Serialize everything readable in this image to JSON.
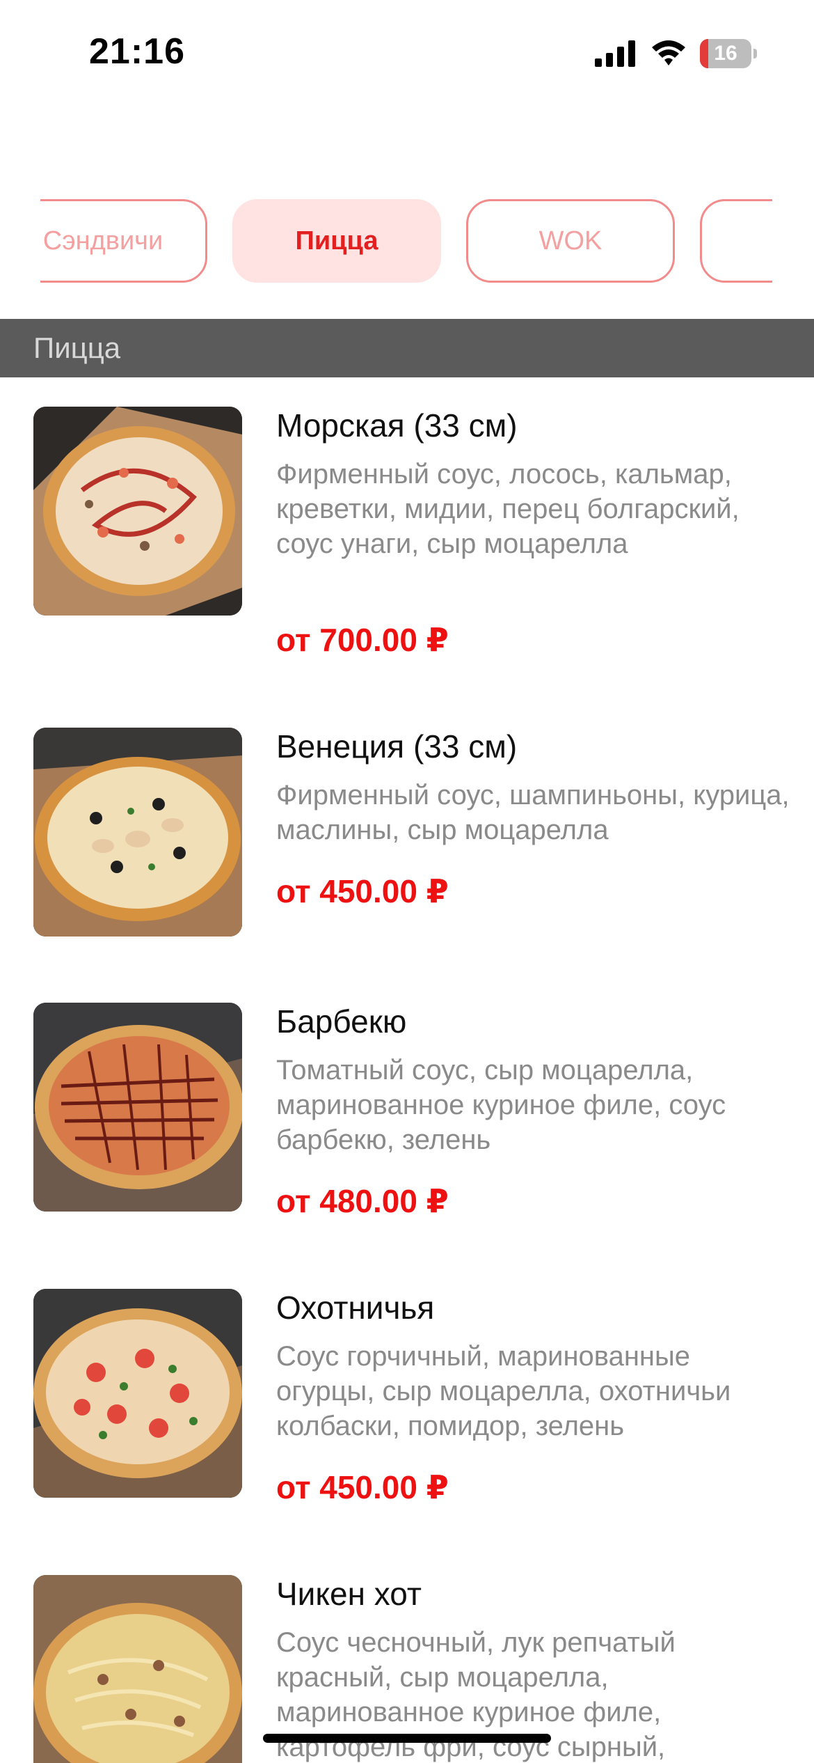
{
  "status_bar": {
    "time": "21:16",
    "battery_level": "16"
  },
  "tabs": [
    {
      "label": "Сэндвичи",
      "active": false
    },
    {
      "label": "Пицца",
      "active": true
    },
    {
      "label": "WOK",
      "active": false
    },
    {
      "label": "",
      "active": false
    }
  ],
  "section": {
    "title": "Пицца"
  },
  "products": [
    {
      "name": "Морская (33 см)",
      "description": "Фирменный соус, лосось, кальмар, креветки, мидии, перец болгарский, соус унаги, сыр моцарелла",
      "price": "от 700.00 ₽"
    },
    {
      "name": "Венеция (33 см)",
      "description": "Фирменный соус, шампиньоны, курица, маслины, сыр моцарелла",
      "price": "от 450.00 ₽"
    },
    {
      "name": "Барбекю",
      "description": "Томатный соус, сыр моцарелла, маринованное куриное филе, соус барбекю, зелень",
      "price": "от 480.00 ₽"
    },
    {
      "name": "Охотничья",
      "description": "Соус горчичный, маринованные огурцы, сыр моцарелла, охотничьи колбаски, помидор, зелень",
      "price": "от 450.00 ₽"
    },
    {
      "name": "Чикен хот",
      "description": "Соус чесночный, лук репчатый красный, сыр моцарелла, маринованное куриное филе, картофель фри, соус сырный,",
      "price": ""
    }
  ],
  "colors": {
    "accent": "#ee1111",
    "tab_border": "#f28b8b",
    "tab_active_bg": "#ffe3e3",
    "section_bg": "#5b5b5b"
  }
}
